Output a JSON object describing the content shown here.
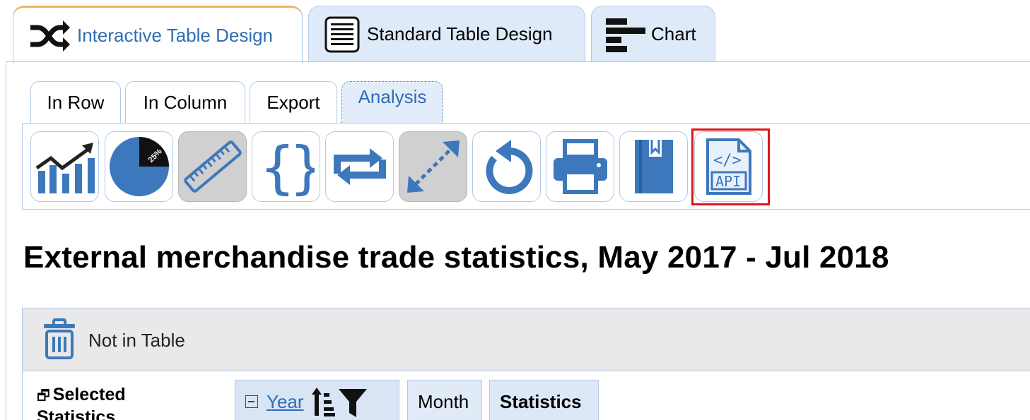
{
  "top_tabs": [
    {
      "label": "Interactive Table Design",
      "icon": "shuffle-icon",
      "active": true
    },
    {
      "label": "Standard Table Design",
      "icon": "table-list-icon",
      "active": false
    },
    {
      "label": "Chart",
      "icon": "bar-chart-icon",
      "active": false
    }
  ],
  "sub_tabs": [
    {
      "label": "In Row"
    },
    {
      "label": "In Column"
    },
    {
      "label": "Export"
    },
    {
      "label": "Analysis",
      "active": true
    }
  ],
  "toolbar": {
    "tools": [
      {
        "icon": "trend-chart-icon"
      },
      {
        "icon": "pie-chart-icon",
        "text": "25%"
      },
      {
        "icon": "ruler-icon",
        "pressed": true
      },
      {
        "icon": "curly-braces-icon"
      },
      {
        "icon": "swap-arrows-icon"
      },
      {
        "icon": "diagonal-resize-icon",
        "pressed": true
      },
      {
        "icon": "undo-icon"
      },
      {
        "icon": "printer-icon"
      },
      {
        "icon": "book-icon"
      },
      {
        "icon": "api-icon",
        "text": "API",
        "highlighted": true
      }
    ],
    "highlight_color": "#e0141c"
  },
  "page": {
    "title": "External merchandise trade statistics, May 2017 - Jul 2018"
  },
  "not_in_table": {
    "label": "Not in Table",
    "icon": "trash-icon"
  },
  "row_dims": {
    "selected_label": "Selected Statistics",
    "year": "Year",
    "month": "Month",
    "statistics": "Statistics"
  },
  "colors": {
    "accent": "#2e6db4",
    "tab_bg": "#dfeaf9",
    "border": "#b2c9e8",
    "active_tab_top": "#f0b463"
  }
}
